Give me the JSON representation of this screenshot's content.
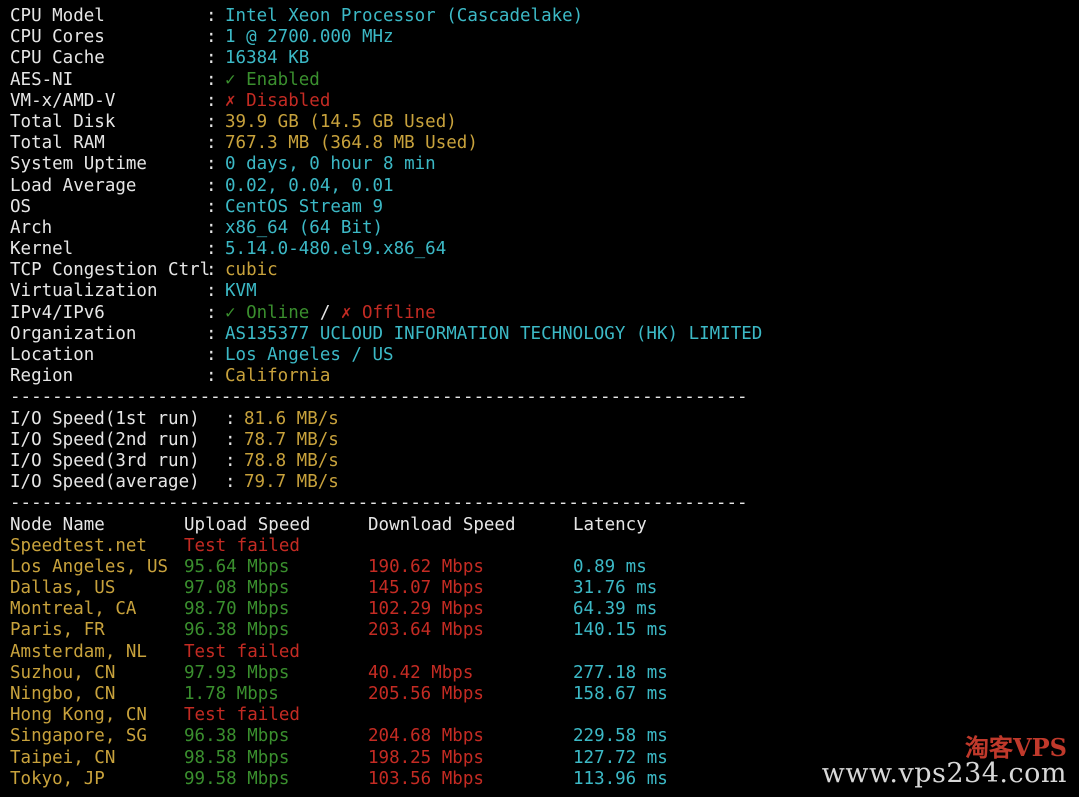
{
  "sysinfo": [
    {
      "label": "CPU Model",
      "sep": ":",
      "value": "Intel Xeon Processor (Cascadelake)",
      "color": "cyan"
    },
    {
      "label": "CPU Cores",
      "sep": ":",
      "value": "1 @ 2700.000 MHz",
      "color": "cyan"
    },
    {
      "label": "CPU Cache",
      "sep": ":",
      "value": "16384 KB",
      "color": "cyan"
    },
    {
      "label": "AES-NI",
      "sep": ":",
      "value": "✓ Enabled",
      "color": "green"
    },
    {
      "label": "VM-x/AMD-V",
      "sep": ":",
      "value": "✗ Disabled",
      "color": "red"
    },
    {
      "label": "Total Disk",
      "sep": ":",
      "value": "39.9 GB (14.5 GB Used)",
      "color": "yellow"
    },
    {
      "label": "Total RAM",
      "sep": ":",
      "value": "767.3 MB (364.8 MB Used)",
      "color": "yellow"
    },
    {
      "label": "System Uptime",
      "sep": ":",
      "value": "0 days, 0 hour 8 min",
      "color": "cyan"
    },
    {
      "label": "Load Average",
      "sep": ":",
      "value": "0.02, 0.04, 0.01",
      "color": "cyan"
    },
    {
      "label": "OS",
      "sep": ":",
      "value": "CentOS Stream 9",
      "color": "cyan"
    },
    {
      "label": "Arch",
      "sep": ":",
      "value": "x86_64 (64 Bit)",
      "color": "cyan"
    },
    {
      "label": "Kernel",
      "sep": ":",
      "value": "5.14.0-480.el9.x86_64",
      "color": "cyan"
    },
    {
      "label": "TCP Congestion Ctrl",
      "sep": ":",
      "value": "cubic",
      "color": "yellow"
    },
    {
      "label": "Virtualization",
      "sep": ":",
      "value": "KVM",
      "color": "cyan"
    }
  ],
  "ipv": {
    "label": "IPv4/IPv6",
    "sep": ":",
    "online": "✓ Online",
    "slash": " / ",
    "offline": "✗ Offline"
  },
  "sysinfo2": [
    {
      "label": "Organization",
      "sep": ":",
      "value": "AS135377 UCLOUD INFORMATION TECHNOLOGY (HK) LIMITED",
      "color": "cyan"
    },
    {
      "label": "Location",
      "sep": ":",
      "value": "Los Angeles / US",
      "color": "cyan"
    },
    {
      "label": "Region",
      "sep": ":",
      "value": "California",
      "color": "yellow"
    }
  ],
  "divider": "----------------------------------------------------------------------",
  "io": [
    {
      "label": "I/O Speed(1st run)",
      "sep": ":",
      "value": "81.6 MB/s"
    },
    {
      "label": "I/O Speed(2nd run)",
      "sep": ":",
      "value": "78.7 MB/s"
    },
    {
      "label": "I/O Speed(3rd run)",
      "sep": ":",
      "value": "78.8 MB/s"
    },
    {
      "label": "I/O Speed(average)",
      "sep": ":",
      "value": "79.7 MB/s"
    }
  ],
  "speed_headers": {
    "node": "Node Name",
    "upload": "Upload Speed",
    "download": "Download Speed",
    "latency": "Latency"
  },
  "speed_rows": [
    {
      "node": "Speedtest.net",
      "failed": "Test failed"
    },
    {
      "node": "Los Angeles, US",
      "upload": "95.64 Mbps",
      "download": "190.62 Mbps",
      "latency": "0.89 ms"
    },
    {
      "node": "Dallas, US",
      "upload": "97.08 Mbps",
      "download": "145.07 Mbps",
      "latency": "31.76 ms"
    },
    {
      "node": "Montreal, CA",
      "upload": "98.70 Mbps",
      "download": "102.29 Mbps",
      "latency": "64.39 ms"
    },
    {
      "node": "Paris, FR",
      "upload": "96.38 Mbps",
      "download": "203.64 Mbps",
      "latency": "140.15 ms"
    },
    {
      "node": "Amsterdam, NL",
      "failed": "Test failed"
    },
    {
      "node": "Suzhou, CN",
      "upload": "97.93 Mbps",
      "download": "40.42 Mbps",
      "latency": "277.18 ms"
    },
    {
      "node": "Ningbo, CN",
      "upload": "1.78 Mbps",
      "download": "205.56 Mbps",
      "latency": "158.67 ms"
    },
    {
      "node": "Hong Kong, CN",
      "failed": "Test failed"
    },
    {
      "node": "Singapore, SG",
      "upload": "96.38 Mbps",
      "download": "204.68 Mbps",
      "latency": "229.58 ms"
    },
    {
      "node": "Taipei, CN",
      "upload": "98.58 Mbps",
      "download": "198.25 Mbps",
      "latency": "127.72 ms"
    },
    {
      "node": "Tokyo, JP",
      "upload": "99.58 Mbps",
      "download": "103.56 Mbps",
      "latency": "113.96 ms"
    }
  ],
  "watermark": {
    "brand": "淘客VPS",
    "url": "www.vps234.com"
  },
  "colors": {
    "cyan": "#3cb9c6",
    "yellow": "#c8a23c",
    "green": "#3a8f2e",
    "red": "#c42b23",
    "white": "#e6e6e6"
  }
}
